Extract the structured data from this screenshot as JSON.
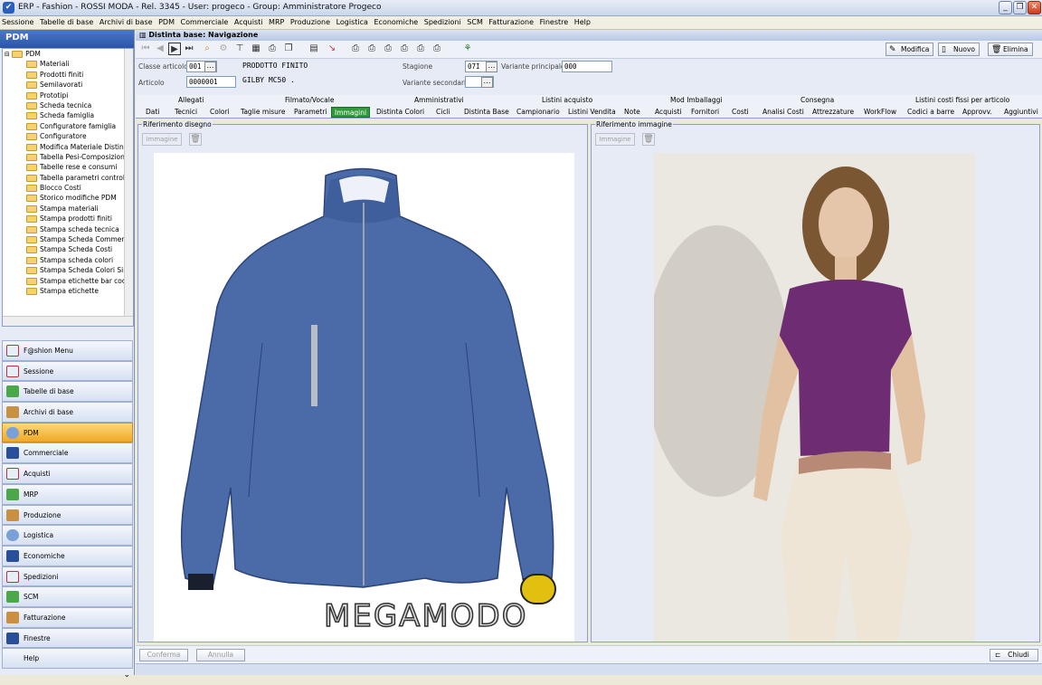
{
  "window": {
    "title": "ERP - Fashion - ROSSI MODA - Rel. 3345 - User: progeco - Group: Amministratore Progeco"
  },
  "menu": [
    "Sessione",
    "Tabelle di base",
    "Archivi di base",
    "PDM",
    "Commerciale",
    "Acquisti",
    "MRP",
    "Produzione",
    "Logistica",
    "Economiche",
    "Spedizioni",
    "SCM",
    "Fatturazione",
    "Finestre",
    "Help"
  ],
  "left": {
    "header": "PDM",
    "tree": [
      "PDM",
      "Materiali",
      "Prodotti finiti",
      "Semilavorati",
      "Prototipi",
      "Scheda tecnica",
      "Scheda famiglia",
      "Configuratore famiglia",
      "Configuratore",
      "Modifica Materiale Distinta",
      "Tabella Pesi-Composizione",
      "Tabelle rese e consumi",
      "Tabella parametri controllo",
      "Blocco Costi",
      "Storico modifiche PDM",
      "Stampa materiali",
      "Stampa prodotti finiti",
      "Stampa scheda tecnica",
      "Stampa Scheda Commercia",
      "Stampa Scheda Costi",
      "Stampa scheda colori",
      "Stampa Scheda Colori Sinte",
      "Stampa etichette bar code",
      "Stampa etichette"
    ],
    "modules": [
      "F@shion Menu",
      "Sessione",
      "Tabelle di base",
      "Archivi di base",
      "PDM",
      "Commerciale",
      "Acquisti",
      "MRP",
      "Produzione",
      "Logistica",
      "Economiche",
      "Spedizioni",
      "SCM",
      "Fatturazione",
      "Finestre",
      "Help"
    ],
    "active_module": "PDM"
  },
  "main": {
    "title": "Distinta base: Navigazione",
    "buttons": {
      "modifica": "Modifica",
      "nuovo": "Nuovo",
      "elimina": "Elimina"
    },
    "form": {
      "classe_label": "Classe articolo",
      "classe_value": "001",
      "classe_desc": "PRODOTTO FINITO",
      "articolo_label": "Articolo",
      "articolo_value": "0000001",
      "articolo_desc": "GILBY MC50 .",
      "stagione_label": "Stagione",
      "stagione_value": "07I",
      "var_princ_label": "Variante principale",
      "var_princ_value": "000",
      "var_sec_label": "Variante secondaria",
      "var_sec_value": ""
    },
    "tab_groups": [
      "Allegati",
      "Filmato/Vocale",
      "Amministrativi",
      "Listini acquisto",
      "Mod Imballaggi",
      "Consegna",
      "Listini costi fissi per articolo"
    ],
    "tabs": [
      "Dati",
      "Tecnici",
      "Colori",
      "Taglie misure",
      "Parametri",
      "Immagini",
      "Distinta Colori",
      "Cicli",
      "Distinta Base",
      "Campionario",
      "Listini Vendita",
      "Note",
      "Acquisti",
      "Fornitori",
      "Costi",
      "Analisi Costi",
      "Attrezzature",
      "WorkFlow",
      "Codici a barre",
      "Approvv.",
      "Aggiuntivi"
    ],
    "active_tab": "Immagini",
    "panels": {
      "left_title": "Riferimento disegno",
      "right_title": "Riferimento immagine",
      "image_button": "Immagine",
      "watermark": "MEGAMODO"
    },
    "bottom": {
      "conferma": "Conferma",
      "annulla": "Annulla",
      "chiudi": "Chiudi"
    }
  }
}
